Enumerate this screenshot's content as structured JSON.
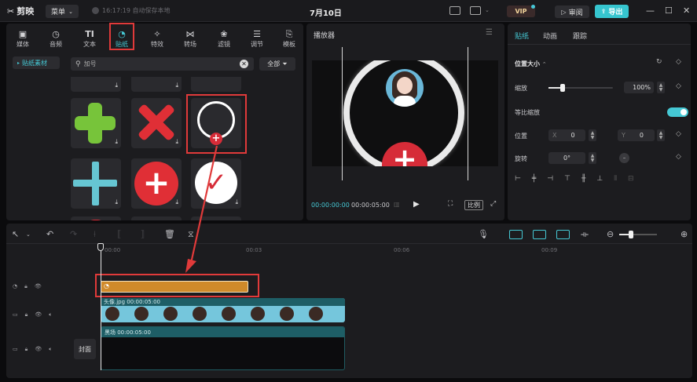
{
  "titlebar": {
    "app_name": "剪映",
    "menu_label": "菜单",
    "save_status": "16:17:19 自动保存本地",
    "project_title": "7月10日",
    "vip_label": "VIP",
    "review_label": "审阅",
    "export_label": "导出"
  },
  "tools": {
    "tabs": [
      {
        "label": "媒体",
        "icon": "media-icon"
      },
      {
        "label": "音频",
        "icon": "audio-icon"
      },
      {
        "label": "文本",
        "icon": "text-icon"
      },
      {
        "label": "贴纸",
        "icon": "sticker-icon"
      },
      {
        "label": "特效",
        "icon": "effects-icon"
      },
      {
        "label": "转场",
        "icon": "transition-icon"
      },
      {
        "label": "滤镜",
        "icon": "filter-icon"
      },
      {
        "label": "调节",
        "icon": "adjust-icon"
      },
      {
        "label": "模板",
        "icon": "template-icon"
      }
    ],
    "active_tab": "贴纸"
  },
  "sticker_panel": {
    "category": "贴纸素材",
    "search_value": "加号",
    "filter_label": "全部"
  },
  "player": {
    "title": "播放器",
    "current_time": "00:00:00:00",
    "total_time": "00:00:05:00",
    "ratio_label": "比例"
  },
  "inspector": {
    "tabs": [
      "贴纸",
      "动画",
      "跟踪"
    ],
    "active_tab": "贴纸",
    "section_title": "位置大小",
    "scale_label": "缩放",
    "scale_value": "100%",
    "uniform_scale_label": "等比缩放",
    "uniform_scale_on": true,
    "position_label": "位置",
    "x_label": "X",
    "x_value": "0",
    "y_label": "Y",
    "y_value": "0",
    "rotate_label": "旋转",
    "rotate_value": "0°"
  },
  "timeline": {
    "ruler": [
      "00:00",
      "00:03",
      "00:06",
      "00:09"
    ],
    "video_clip_label": "头像.jpg  00:00:05:00",
    "bg_clip_label": "黑场  00:00:05:00",
    "cover_label": "封面"
  },
  "colors": {
    "accent": "#45c8d4",
    "sticker_clip": "#d08a2a",
    "highlight": "#e03a3a"
  }
}
